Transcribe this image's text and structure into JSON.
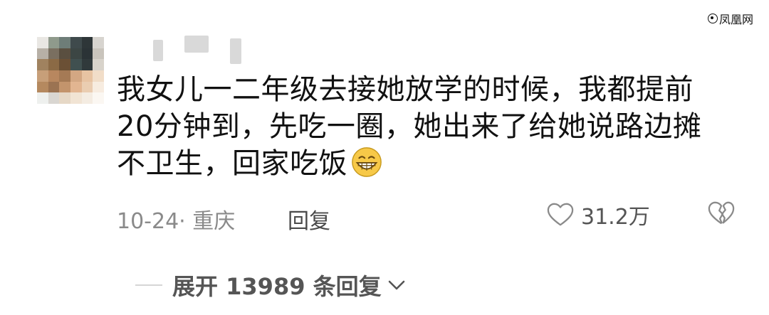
{
  "watermark": {
    "text": "凤凰网",
    "icon": "phoenix-logo-icon"
  },
  "comment": {
    "lines": [
      "我女儿一二年级去接她放学的时候，我都提前",
      "20分钟到，先吃一圈，她出来了给她说路边摊",
      "不卫生，回家吃饭"
    ],
    "emoji": "grinning-face-icon",
    "date_location": "10-24· 重庆",
    "reply_label": "回复",
    "like_count": "31.2万"
  },
  "expand_replies_label": "展开 13989 条回复",
  "colors": {
    "text": "#111111",
    "meta": "#8a8a8a",
    "emoji_face": "#f7c948"
  }
}
